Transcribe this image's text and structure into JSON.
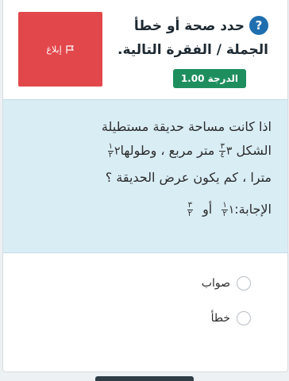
{
  "header": {
    "report_label": "إبلاغ",
    "question_icon": "question-mark-icon",
    "question_mark": "?",
    "title_line1": "حدد صحة أو خطأ",
    "title_line2": "الجملة / الفقرة التالية.",
    "grade_label": "الدرجة 1.00"
  },
  "question": {
    "line1": "اذا كانت مساحة حديقة مستطيلة",
    "line2_a": "الشكل",
    "line2_frac1": {
      "whole": "٣",
      "num": "٣",
      "den": "٤"
    },
    "line2_b": "متر مربع ، وطولها",
    "line2_frac2": {
      "whole": "٢",
      "num": "١",
      "den": "٢"
    },
    "line3": "مترا ، كم يكون عرض الحديقة ؟",
    "line4_a": "الإجابة:",
    "line4_frac1": {
      "whole": "١",
      "num": "١",
      "den": "٢"
    },
    "line4_or": "أو",
    "line4_frac2": {
      "num": "٣",
      "den": "٢"
    }
  },
  "options": [
    {
      "label": "صواب"
    },
    {
      "label": "خطأ"
    }
  ],
  "colors": {
    "accent_blue": "#1f6fb0",
    "report_red": "#e2474b",
    "grade_green": "#1e8e5e",
    "question_bg": "#d9edf5"
  }
}
